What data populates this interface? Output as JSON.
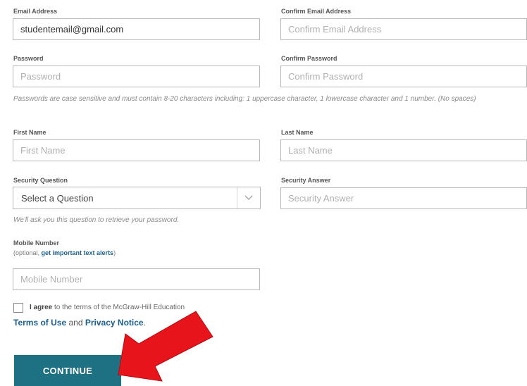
{
  "fields": {
    "email": {
      "label": "Email Address",
      "value": "studentemail@gmail.com",
      "placeholder": ""
    },
    "confirm_email": {
      "label": "Confirm Email Address",
      "value": "",
      "placeholder": "Confirm Email Address"
    },
    "password": {
      "label": "Password",
      "value": "",
      "placeholder": "Password"
    },
    "confirm_password": {
      "label": "Confirm Password",
      "value": "",
      "placeholder": "Confirm Password"
    },
    "first_name": {
      "label": "First Name",
      "value": "",
      "placeholder": "First Name"
    },
    "last_name": {
      "label": "Last Name",
      "value": "",
      "placeholder": "Last Name"
    },
    "security_question": {
      "label": "Security Question",
      "selected": "Select a Question"
    },
    "security_answer": {
      "label": "Security Answer",
      "value": "",
      "placeholder": "Security Answer"
    },
    "mobile": {
      "label": "Mobile Number",
      "optional_text": "(optional,",
      "alerts_link": "get important text alerts",
      "close_paren": ")",
      "value": "",
      "placeholder": "Mobile Number"
    }
  },
  "hints": {
    "password": "Passwords are case sensitive and must contain 8-20 characters including: 1 uppercase character, 1 lowercase character and 1 number. (No spaces)",
    "security": "We'll ask you this question to retrieve your password."
  },
  "agreement": {
    "bold": "I agree",
    "text": "to the terms of the McGraw-Hill Education",
    "terms_link": "Terms of Use",
    "and": "and",
    "privacy_link": "Privacy Notice",
    "period": ".",
    "checked": false
  },
  "continue_label": "CONTINUE",
  "icons": {
    "chevron": "chevron-down-icon",
    "annotation": "red-arrow-annotation"
  },
  "colors": {
    "button": "#1d7183",
    "link": "#1a5f8f",
    "arrow": "#e8141b"
  }
}
